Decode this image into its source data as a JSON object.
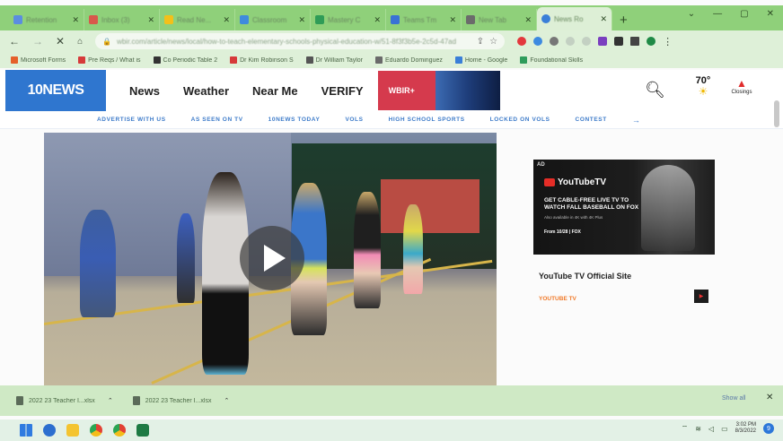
{
  "browser": {
    "tabs": [
      {
        "title": "Retention",
        "color": "#5b8de0"
      },
      {
        "title": "Inbox (3)",
        "color": "#d8584b"
      },
      {
        "title": "Read Ne...",
        "color": "#f3c019"
      },
      {
        "title": "Classroom",
        "color": "#3f8bdc"
      },
      {
        "title": "Mastery C",
        "color": "#2f9c57"
      },
      {
        "title": "Teams Tm",
        "color": "#3972d5"
      },
      {
        "title": "New Tab",
        "color": "#6b6b6b"
      },
      {
        "title": "News Ro",
        "color": "#3a7fd8",
        "active": true
      }
    ],
    "new_tab_label": "+",
    "window_controls": [
      "⌄",
      "—",
      "▢",
      "✕"
    ],
    "url": "wbir.com/article/news/local/how-to-teach-elementary-schools-physical-education-w/51-8f3f3b5e-2c5d-47ad",
    "bookmarks": [
      {
        "label": "Microsoft Forms",
        "color": "#e5602b"
      },
      {
        "label": "Pre Reqs / What is",
        "color": "#d63a3a"
      },
      {
        "label": "Co  Periodic Table 2",
        "color": "#333333"
      },
      {
        "label": "Dr Kim Robinson S",
        "color": "#d63a3a"
      },
      {
        "label": "Dr William Taylor",
        "color": "#555555"
      },
      {
        "label": "Eduardo Dominguez",
        "color": "#6a6a6a"
      },
      {
        "label": "Home - Google",
        "color": "#3a7fd8"
      },
      {
        "label": "Foundational Skills",
        "color": "#2e9c5b"
      }
    ]
  },
  "site": {
    "logo": "10NEWS",
    "nav": [
      "News",
      "Weather",
      "Near Me",
      "VERIFY"
    ],
    "promo_label": "WBIR+",
    "weather_temp": "70°",
    "closings_label": "Closings",
    "subnav": [
      "ADVERTISE WITH US",
      "AS SEEN ON TV",
      "10NEWS TODAY",
      "VOLS",
      "HIGH SCHOOL SPORTS",
      "LOCKED ON VOLS",
      "CONTEST"
    ],
    "subnav_more": "→"
  },
  "ad": {
    "label": "AD",
    "brand": "YouTubeTV",
    "headline": "GET CABLE-FREE LIVE TV TO WATCH FALL BASEBALL ON FOX",
    "subline": "Also available in 4K with 4K Plus",
    "from_line": "From 10/28 | FOX",
    "title": "YouTube TV Official Site",
    "source": "YOUTUBE TV"
  },
  "downloads": {
    "items": [
      "2022 23 Teacher I...xlsx",
      "2022 23 Teacher I...xlsx"
    ],
    "show_all": "Show all",
    "close": "✕"
  },
  "taskbar": {
    "time": "3:02 PM",
    "date": "8/3/2022"
  }
}
